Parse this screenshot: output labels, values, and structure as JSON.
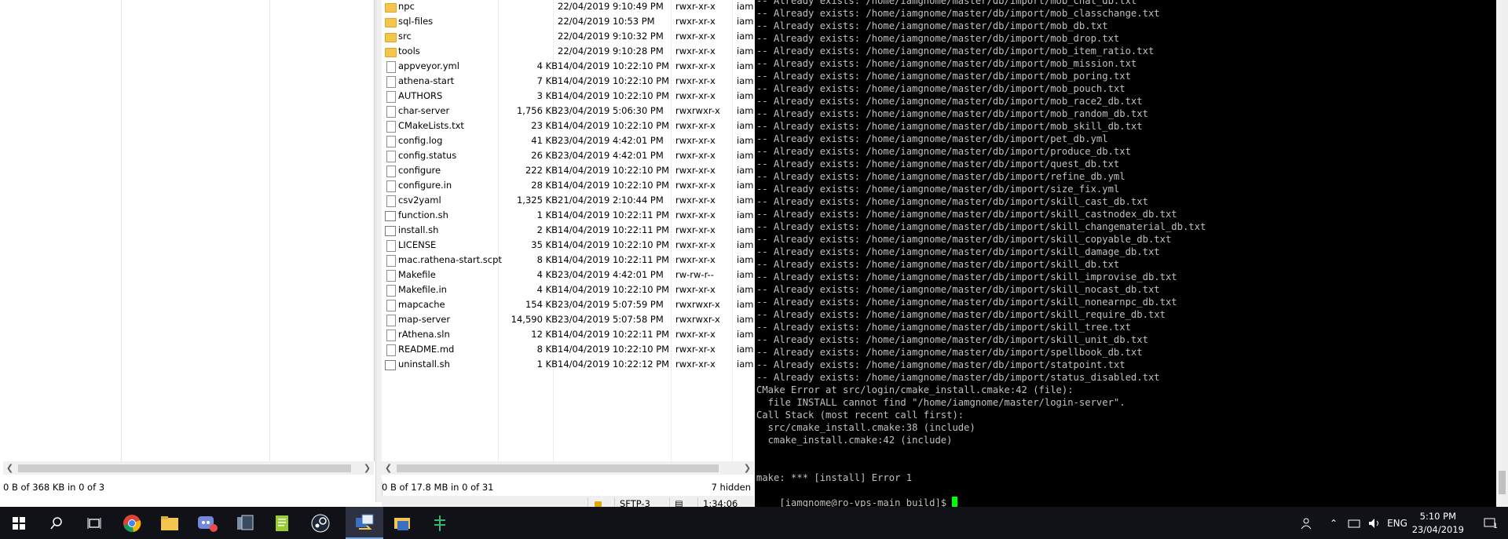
{
  "local_pane": {
    "status": "0 B of 368 KB in 0 of 3"
  },
  "remote_pane": {
    "files": [
      {
        "name": "npc",
        "size": "",
        "date": "22/04/2019 9:10:49 PM",
        "perm": "rwxr-xr-x",
        "owner": "iam",
        "icon": "folder"
      },
      {
        "name": "sql-files",
        "size": "",
        "date": "22/04/2019 10:53 PM",
        "perm": "rwxr-xr-x",
        "owner": "iam",
        "icon": "folder"
      },
      {
        "name": "src",
        "size": "",
        "date": "22/04/2019 9:10:32 PM",
        "perm": "rwxr-xr-x",
        "owner": "iam",
        "icon": "folder"
      },
      {
        "name": "tools",
        "size": "",
        "date": "22/04/2019 9:10:28 PM",
        "perm": "rwxr-xr-x",
        "owner": "iam",
        "icon": "folder"
      },
      {
        "name": "appveyor.yml",
        "size": "4 KB",
        "date": "14/04/2019 10:22:10 PM",
        "perm": "rwxr-xr-x",
        "owner": "iam",
        "icon": "file"
      },
      {
        "name": "athena-start",
        "size": "7 KB",
        "date": "14/04/2019 10:22:10 PM",
        "perm": "rwxr-xr-x",
        "owner": "iam",
        "icon": "file"
      },
      {
        "name": "AUTHORS",
        "size": "3 KB",
        "date": "14/04/2019 10:22:10 PM",
        "perm": "rwxr-xr-x",
        "owner": "iam",
        "icon": "file"
      },
      {
        "name": "char-server",
        "size": "1,756 KB",
        "date": "23/04/2019 5:06:30 PM",
        "perm": "rwxrwxr-x",
        "owner": "iam",
        "icon": "file"
      },
      {
        "name": "CMakeLists.txt",
        "size": "23 KB",
        "date": "14/04/2019 10:22:10 PM",
        "perm": "rwxr-xr-x",
        "owner": "iam",
        "icon": "file"
      },
      {
        "name": "config.log",
        "size": "41 KB",
        "date": "23/04/2019 4:42:01 PM",
        "perm": "rwxr-xr-x",
        "owner": "iam",
        "icon": "file"
      },
      {
        "name": "config.status",
        "size": "26 KB",
        "date": "23/04/2019 4:42:01 PM",
        "perm": "rwxr-xr-x",
        "owner": "iam",
        "icon": "file"
      },
      {
        "name": "configure",
        "size": "222 KB",
        "date": "14/04/2019 10:22:10 PM",
        "perm": "rwxr-xr-x",
        "owner": "iam",
        "icon": "file"
      },
      {
        "name": "configure.in",
        "size": "28 KB",
        "date": "14/04/2019 10:22:10 PM",
        "perm": "rwxr-xr-x",
        "owner": "iam",
        "icon": "file"
      },
      {
        "name": "csv2yaml",
        "size": "1,325 KB",
        "date": "21/04/2019 2:10:44 PM",
        "perm": "rwxr-xr-x",
        "owner": "iam",
        "icon": "file"
      },
      {
        "name": "function.sh",
        "size": "1 KB",
        "date": "14/04/2019 10:22:11 PM",
        "perm": "rwxr-xr-x",
        "owner": "iam",
        "icon": "script"
      },
      {
        "name": "install.sh",
        "size": "2 KB",
        "date": "14/04/2019 10:22:11 PM",
        "perm": "rwxr-xr-x",
        "owner": "iam",
        "icon": "script"
      },
      {
        "name": "LICENSE",
        "size": "35 KB",
        "date": "14/04/2019 10:22:10 PM",
        "perm": "rwxr-xr-x",
        "owner": "iam",
        "icon": "file"
      },
      {
        "name": "mac.rathena-start.scpt",
        "size": "8 KB",
        "date": "14/04/2019 10:22:11 PM",
        "perm": "rwxr-xr-x",
        "owner": "iam",
        "icon": "file"
      },
      {
        "name": "Makefile",
        "size": "4 KB",
        "date": "23/04/2019 4:42:01 PM",
        "perm": "rw-rw-r--",
        "owner": "iam",
        "icon": "file"
      },
      {
        "name": "Makefile.in",
        "size": "4 KB",
        "date": "14/04/2019 10:22:10 PM",
        "perm": "rwxr-xr-x",
        "owner": "iam",
        "icon": "file"
      },
      {
        "name": "mapcache",
        "size": "154 KB",
        "date": "23/04/2019 5:07:59 PM",
        "perm": "rwxrwxr-x",
        "owner": "iam",
        "icon": "file"
      },
      {
        "name": "map-server",
        "size": "14,590 KB",
        "date": "23/04/2019 5:07:58 PM",
        "perm": "rwxrwxr-x",
        "owner": "iam",
        "icon": "file"
      },
      {
        "name": "rAthena.sln",
        "size": "12 KB",
        "date": "14/04/2019 10:22:11 PM",
        "perm": "rwxr-xr-x",
        "owner": "iam",
        "icon": "file"
      },
      {
        "name": "README.md",
        "size": "8 KB",
        "date": "14/04/2019 10:22:10 PM",
        "perm": "rwxr-xr-x",
        "owner": "iam",
        "icon": "file"
      },
      {
        "name": "uninstall.sh",
        "size": "1 KB",
        "date": "14/04/2019 10:22:12 PM",
        "perm": "rwxr-xr-x",
        "owner": "iam",
        "icon": "script"
      }
    ],
    "status": "0 B of 17.8 MB in 0 of 31",
    "hidden": "7 hidden"
  },
  "status_bar": {
    "protocol": "SFTP-3",
    "elapsed": "1:34:06"
  },
  "terminal": {
    "lines": [
      "-- Already exists: /home/iamgnome/master/db/import/mob_chat_db.txt",
      "-- Already exists: /home/iamgnome/master/db/import/mob_classchange.txt",
      "-- Already exists: /home/iamgnome/master/db/import/mob_db.txt",
      "-- Already exists: /home/iamgnome/master/db/import/mob_drop.txt",
      "-- Already exists: /home/iamgnome/master/db/import/mob_item_ratio.txt",
      "-- Already exists: /home/iamgnome/master/db/import/mob_mission.txt",
      "-- Already exists: /home/iamgnome/master/db/import/mob_poring.txt",
      "-- Already exists: /home/iamgnome/master/db/import/mob_pouch.txt",
      "-- Already exists: /home/iamgnome/master/db/import/mob_race2_db.txt",
      "-- Already exists: /home/iamgnome/master/db/import/mob_random_db.txt",
      "-- Already exists: /home/iamgnome/master/db/import/mob_skill_db.txt",
      "-- Already exists: /home/iamgnome/master/db/import/pet_db.yml",
      "-- Already exists: /home/iamgnome/master/db/import/produce_db.txt",
      "-- Already exists: /home/iamgnome/master/db/import/quest_db.txt",
      "-- Already exists: /home/iamgnome/master/db/import/refine_db.yml",
      "-- Already exists: /home/iamgnome/master/db/import/size_fix.yml",
      "-- Already exists: /home/iamgnome/master/db/import/skill_cast_db.txt",
      "-- Already exists: /home/iamgnome/master/db/import/skill_castnodex_db.txt",
      "-- Already exists: /home/iamgnome/master/db/import/skill_changematerial_db.txt",
      "-- Already exists: /home/iamgnome/master/db/import/skill_copyable_db.txt",
      "-- Already exists: /home/iamgnome/master/db/import/skill_damage_db.txt",
      "-- Already exists: /home/iamgnome/master/db/import/skill_db.txt",
      "-- Already exists: /home/iamgnome/master/db/import/skill_improvise_db.txt",
      "-- Already exists: /home/iamgnome/master/db/import/skill_nocast_db.txt",
      "-- Already exists: /home/iamgnome/master/db/import/skill_nonearnpc_db.txt",
      "-- Already exists: /home/iamgnome/master/db/import/skill_require_db.txt",
      "-- Already exists: /home/iamgnome/master/db/import/skill_tree.txt",
      "-- Already exists: /home/iamgnome/master/db/import/skill_unit_db.txt",
      "-- Already exists: /home/iamgnome/master/db/import/spellbook_db.txt",
      "-- Already exists: /home/iamgnome/master/db/import/statpoint.txt",
      "-- Already exists: /home/iamgnome/master/db/import/status_disabled.txt",
      "CMake Error at src/login/cmake_install.cmake:42 (file):",
      "  file INSTALL cannot find \"/home/iamgnome/master/login-server\".",
      "Call Stack (most recent call first):",
      "  src/cmake_install.cmake:38 (include)",
      "  cmake_install.cmake:42 (include)",
      "",
      "",
      "make: *** [install] Error 1"
    ],
    "prompt": "[iamgnome@ro-vps-main build]$ "
  },
  "taskbar": {
    "apps": [
      {
        "name": "chrome",
        "active": false
      },
      {
        "name": "file-explorer",
        "active": false
      },
      {
        "name": "discord",
        "active": false
      },
      {
        "name": "app-1",
        "active": false
      },
      {
        "name": "notepad-plus-plus",
        "active": false
      },
      {
        "name": "steam",
        "active": false
      },
      {
        "name": "winscp",
        "active": true
      },
      {
        "name": "app-2",
        "active": false
      },
      {
        "name": "app-3",
        "active": false
      }
    ],
    "language": "ENG",
    "time": "5:10 PM",
    "date": "23/04/2019",
    "notification_count": "1"
  }
}
